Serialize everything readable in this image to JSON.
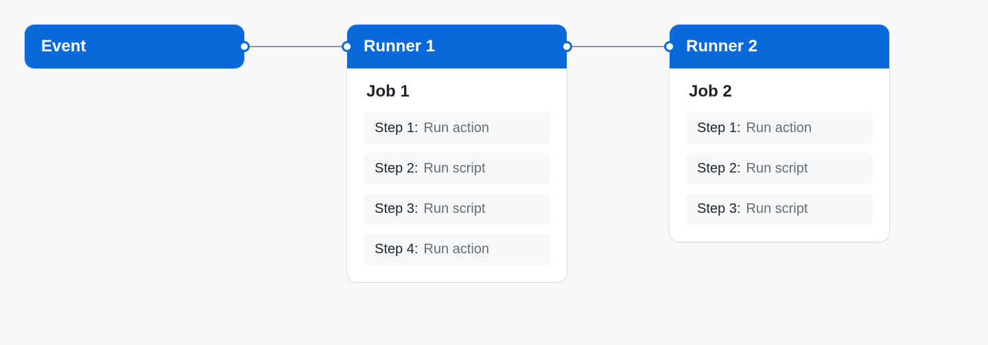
{
  "colors": {
    "background": "#f6f8fa",
    "header_bg": "#0969da",
    "header_text": "#ffffff",
    "card_bg": "#ffffff",
    "step_bg": "#f6f8fa",
    "text_primary": "#1f2328",
    "text_secondary": "#656d76",
    "connector": "#8c959f"
  },
  "nodes": {
    "event": {
      "title": "Event"
    },
    "runner1": {
      "title": "Runner 1",
      "job_title": "Job 1",
      "steps": [
        {
          "label": "Step 1:",
          "desc": "Run action"
        },
        {
          "label": "Step 2:",
          "desc": "Run script"
        },
        {
          "label": "Step 3:",
          "desc": "Run script"
        },
        {
          "label": "Step 4:",
          "desc": "Run action"
        }
      ]
    },
    "runner2": {
      "title": "Runner 2",
      "job_title": "Job 2",
      "steps": [
        {
          "label": "Step 1:",
          "desc": "Run action"
        },
        {
          "label": "Step 2:",
          "desc": "Run script"
        },
        {
          "label": "Step 3:",
          "desc": "Run script"
        }
      ]
    }
  }
}
